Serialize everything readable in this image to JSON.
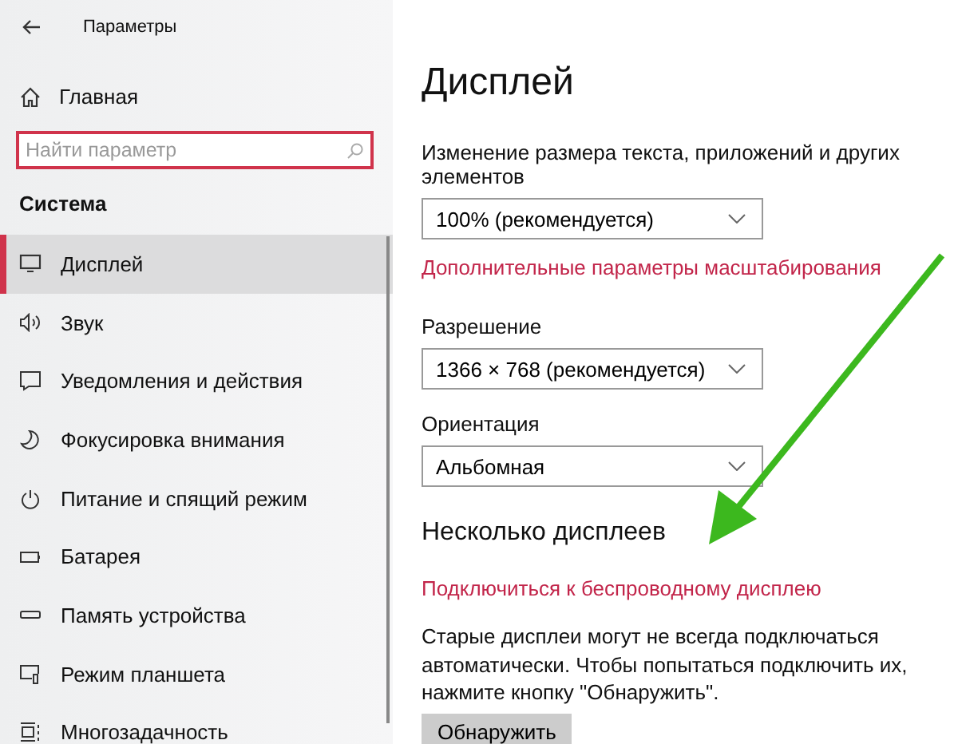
{
  "window": {
    "title": "Параметры"
  },
  "sidebar": {
    "home": "Главная",
    "search": {
      "placeholder": "Найти параметр"
    },
    "section": "Система",
    "items": [
      {
        "label": "Дисплей",
        "kind": "display",
        "selected": true
      },
      {
        "label": "Звук",
        "kind": "sound",
        "selected": false
      },
      {
        "label": "Уведомления и действия",
        "kind": "notifications",
        "selected": false
      },
      {
        "label": "Фокусировка внимания",
        "kind": "focus",
        "selected": false
      },
      {
        "label": "Питание и спящий режим",
        "kind": "power",
        "selected": false
      },
      {
        "label": "Батарея",
        "kind": "battery",
        "selected": false
      },
      {
        "label": "Память устройства",
        "kind": "storage",
        "selected": false
      },
      {
        "label": "Режим планшета",
        "kind": "tablet",
        "selected": false
      },
      {
        "label": "Многозадачность",
        "kind": "multitask",
        "selected": false
      }
    ]
  },
  "content": {
    "title": "Дисплей",
    "scale": {
      "label": "Изменение размера текста, приложений и других элементов",
      "value": "100% (рекомендуется)",
      "link": "Дополнительные параметры масштабирования"
    },
    "resolution": {
      "label": "Разрешение",
      "value": "1366 × 768 (рекомендуется)"
    },
    "orientation": {
      "label": "Ориентация",
      "value": "Альбомная"
    },
    "multi": {
      "heading": "Несколько дисплеев",
      "link": "Подключиться к беспроводному дисплею",
      "text": "Старые дисплеи могут не всегда подключаться автоматически. Чтобы попытаться подключить их, нажмите кнопку \"Обнаружить\".",
      "button": "Обнаружить"
    }
  }
}
